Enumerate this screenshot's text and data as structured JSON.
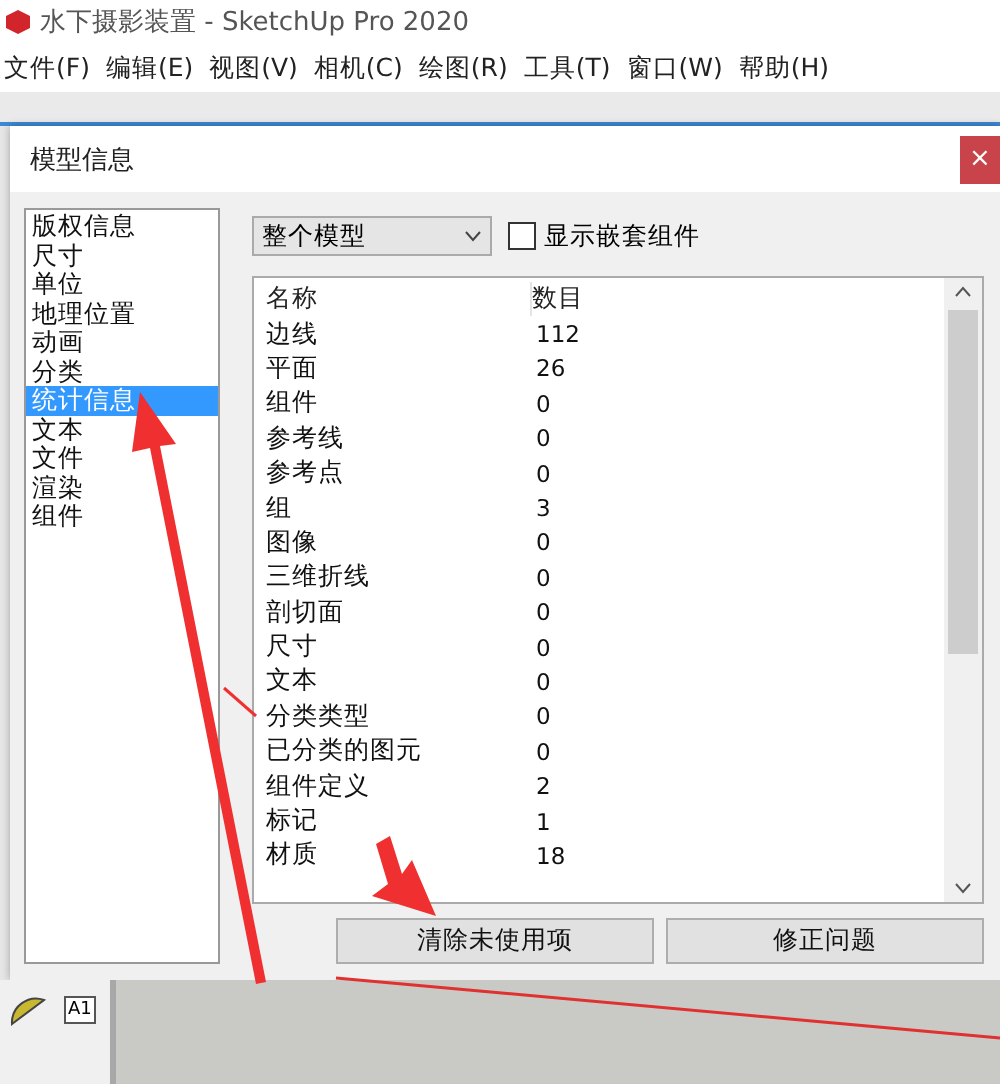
{
  "app_window": {
    "title": "水下摄影装置 - SketchUp Pro 2020"
  },
  "menu": [
    "文件(F)",
    "编辑(E)",
    "视图(V)",
    "相机(C)",
    "绘图(R)",
    "工具(T)",
    "窗口(W)",
    "帮助(H)"
  ],
  "dialog": {
    "title": "模型信息",
    "close": "×",
    "categories": [
      {
        "label": "版权信息",
        "selected": false
      },
      {
        "label": "尺寸",
        "selected": false
      },
      {
        "label": "单位",
        "selected": false
      },
      {
        "label": "地理位置",
        "selected": false
      },
      {
        "label": "动画",
        "selected": false
      },
      {
        "label": "分类",
        "selected": false
      },
      {
        "label": "统计信息",
        "selected": true
      },
      {
        "label": "文本",
        "selected": false
      },
      {
        "label": "文件",
        "selected": false
      },
      {
        "label": "渲染",
        "selected": false
      },
      {
        "label": "组件",
        "selected": false
      }
    ],
    "scope_select": {
      "value": "整个模型"
    },
    "show_nested": {
      "label": "显示嵌套组件",
      "checked": false
    },
    "table": {
      "columns": [
        "名称",
        "数目"
      ],
      "rows": [
        [
          "边线",
          "112"
        ],
        [
          "平面",
          "26"
        ],
        [
          "组件",
          "0"
        ],
        [
          "参考线",
          "0"
        ],
        [
          "参考点",
          "0"
        ],
        [
          "组",
          "3"
        ],
        [
          "图像",
          "0"
        ],
        [
          "三维折线",
          "0"
        ],
        [
          "剖切面",
          "0"
        ],
        [
          "尺寸",
          "0"
        ],
        [
          "文本",
          "0"
        ],
        [
          "分类类型",
          "0"
        ],
        [
          "已分类的图元",
          "0"
        ],
        [
          "组件定义",
          "2"
        ],
        [
          "标记",
          "1"
        ],
        [
          "材质",
          "18"
        ]
      ]
    },
    "buttons": [
      "清除未使用项",
      "修正问题"
    ]
  },
  "bottom_tools": {
    "text_tool_label": "A1"
  }
}
